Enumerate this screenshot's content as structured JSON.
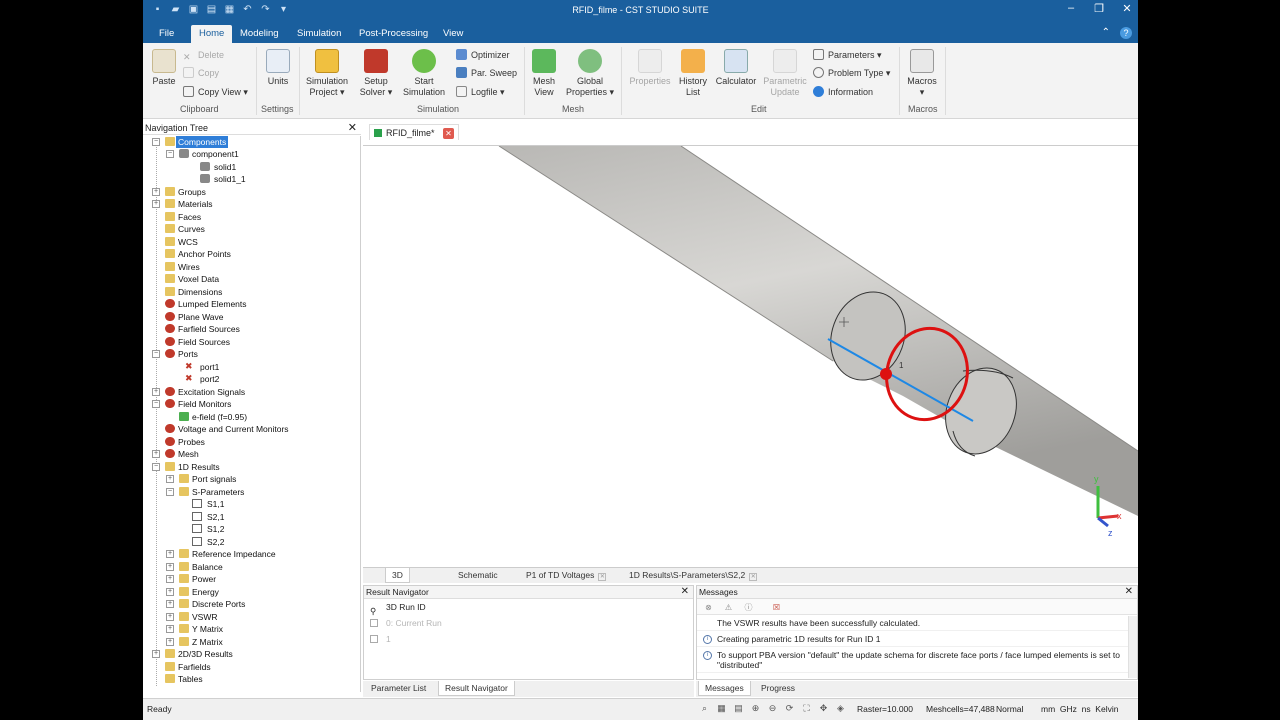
{
  "window": {
    "title": "RFID_filme - CST STUDIO SUITE"
  },
  "quick_access": [
    "new-icon",
    "open-icon",
    "save-icon",
    "save-as-icon",
    "print-icon",
    "undo-icon",
    "redo-icon",
    "customize-icon"
  ],
  "ribbon_tabs": [
    "File",
    "Home",
    "Modeling",
    "Simulation",
    "Post-Processing",
    "View"
  ],
  "ribbon": {
    "paste": "Paste",
    "delete": "Delete",
    "copy": "Copy",
    "copy_view": "Copy View",
    "clipboard_group": "Clipboard",
    "units": "Units",
    "settings_group": "Settings",
    "simulation_project": "Simulation Project",
    "setup_solver": "Setup Solver",
    "start_simulation": "Start Simulation",
    "optimizer": "Optimizer",
    "par_sweep": "Par. Sweep",
    "logfile": "Logfile",
    "simulation_group": "Simulation",
    "mesh_view": "Mesh View",
    "global_properties": "Global Properties",
    "mesh_group": "Mesh",
    "properties": "Properties",
    "history_list": "History List",
    "calculator": "Calculator",
    "parametric_update": "Parametric Update",
    "parameters": "Parameters",
    "problem_type": "Problem Type",
    "information": "Information",
    "edit_group": "Edit",
    "macros": "Macros",
    "macros_group": "Macros"
  },
  "nav_tree": {
    "title": "Navigation Tree",
    "items": [
      {
        "label": "Components",
        "selected": true
      },
      {
        "label": "component1"
      },
      {
        "label": "solid1"
      },
      {
        "label": "solid1_1"
      },
      {
        "label": "Groups"
      },
      {
        "label": "Materials"
      },
      {
        "label": "Faces"
      },
      {
        "label": "Curves"
      },
      {
        "label": "WCS"
      },
      {
        "label": "Anchor Points"
      },
      {
        "label": "Wires"
      },
      {
        "label": "Voxel Data"
      },
      {
        "label": "Dimensions"
      },
      {
        "label": "Lumped Elements"
      },
      {
        "label": "Plane Wave"
      },
      {
        "label": "Farfield Sources"
      },
      {
        "label": "Field Sources"
      },
      {
        "label": "Ports"
      },
      {
        "label": "port1"
      },
      {
        "label": "port2"
      },
      {
        "label": "Excitation Signals"
      },
      {
        "label": "Field Monitors"
      },
      {
        "label": "e-field (f=0.95)"
      },
      {
        "label": "Voltage and Current Monitors"
      },
      {
        "label": "Probes"
      },
      {
        "label": "Mesh"
      },
      {
        "label": "1D Results"
      },
      {
        "label": "Port signals"
      },
      {
        "label": "S-Parameters"
      },
      {
        "label": "S1,1"
      },
      {
        "label": "S2,1"
      },
      {
        "label": "S1,2"
      },
      {
        "label": "S2,2"
      },
      {
        "label": "Reference Impedance"
      },
      {
        "label": "Balance"
      },
      {
        "label": "Power"
      },
      {
        "label": "Energy"
      },
      {
        "label": "Discrete Ports"
      },
      {
        "label": "VSWR"
      },
      {
        "label": "Y Matrix"
      },
      {
        "label": "Z Matrix"
      },
      {
        "label": "2D/3D Results"
      },
      {
        "label": "Farfields"
      },
      {
        "label": "Tables"
      }
    ]
  },
  "document_tab": "RFID_filme*",
  "viewport": {
    "axis_y": "y",
    "axis_x": "x",
    "axis_z": "z",
    "port_label": "1"
  },
  "view_tabs": [
    {
      "label": "3D",
      "active": true
    },
    {
      "label": "Schematic"
    },
    {
      "label": "P1 of TD Voltages"
    },
    {
      "label": "1D Results\\S-Parameters\\S2,2"
    }
  ],
  "result_navigator": {
    "title": "Result Navigator",
    "rows": [
      "3D Run ID",
      "0: Current Run",
      "1"
    ]
  },
  "bottom_left_tabs": [
    "Parameter List",
    "Result Navigator"
  ],
  "messages": {
    "title": "Messages",
    "lines": [
      "The VSWR results have been successfully calculated.",
      "Creating parametric 1D results for Run ID 1",
      "To support PBA version \"default\" the update schema for discrete face ports / face lumped elements is set to \"distributed\""
    ]
  },
  "bottom_right_tabs": [
    "Messages",
    "Progress"
  ],
  "status": {
    "ready": "Ready",
    "raster": "Raster=10.000",
    "meshcells": "Meshcells=47,488",
    "mode": "Normal",
    "units": "mm  GHz  ns  Kelvin"
  },
  "colors": {
    "titlebar": "#1a5f9e",
    "selection": "#2f7ed8",
    "port_ring": "#dd1111",
    "port_line": "#1e88e5"
  }
}
